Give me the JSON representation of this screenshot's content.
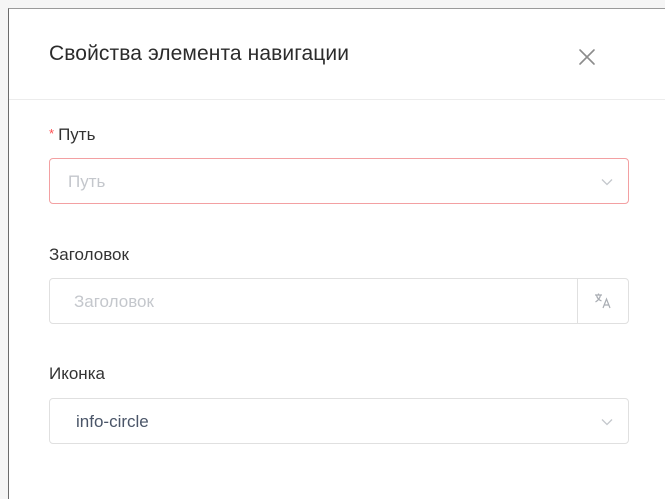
{
  "dialog": {
    "title": "Свойства элемента навигации",
    "close_icon": "close-icon"
  },
  "fields": {
    "path": {
      "required_mark": "*",
      "label": "Путь",
      "placeholder": "Путь",
      "value": "",
      "state": "error"
    },
    "heading": {
      "label": "Заголовок",
      "placeholder": "Заголовок",
      "value": "",
      "addon_icon": "translate-icon"
    },
    "icon": {
      "label": "Иконка",
      "value": "info-circle"
    }
  },
  "colors": {
    "error_border": "#f3a0a2",
    "required_mark": "#ff4d4f",
    "placeholder": "#c4c7cc",
    "value_text": "#4a5568"
  }
}
